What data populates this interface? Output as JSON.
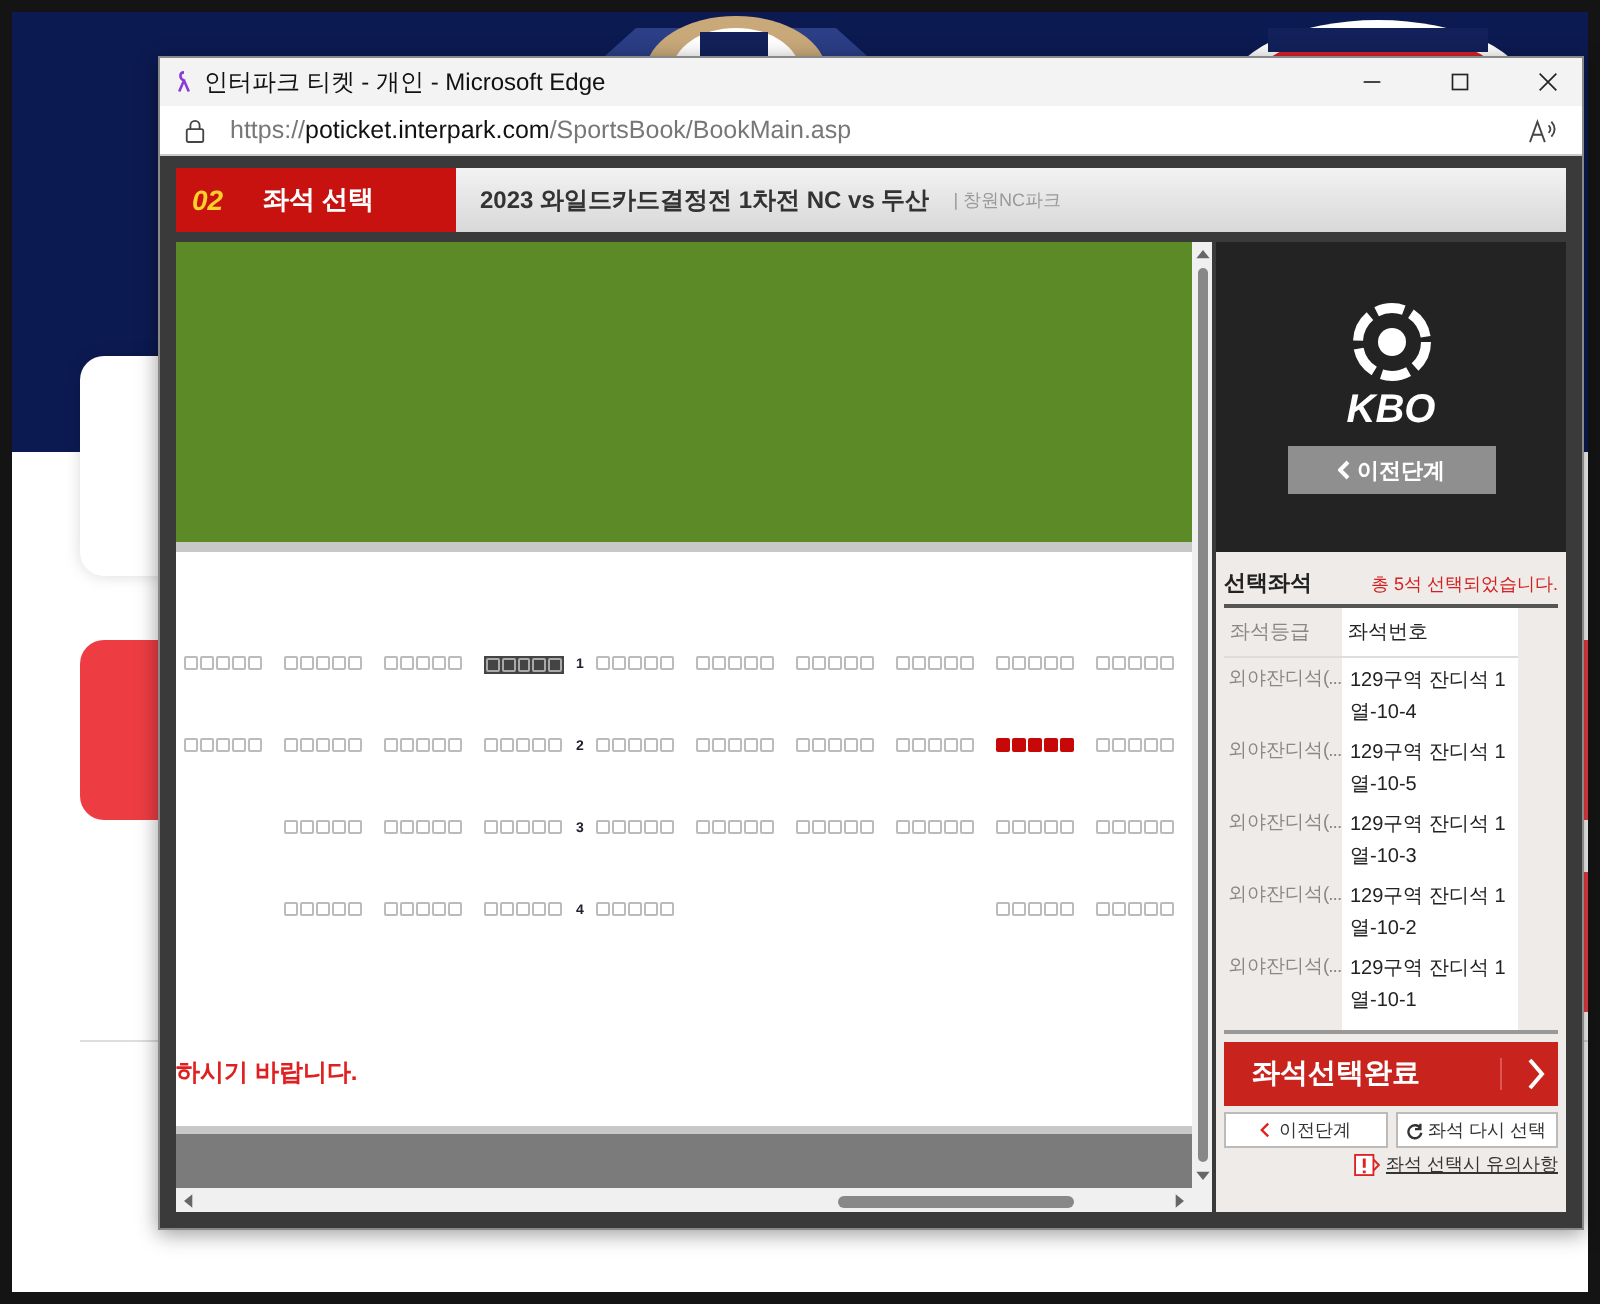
{
  "window": {
    "title": "인터파크 티켓 - 개인 - Microsoft Edge"
  },
  "address_bar": {
    "scheme": "https://",
    "host": "poticket.interpark.com",
    "path": "/SportsBook/BookMain.asp"
  },
  "step": {
    "number": "02",
    "label": "좌석 선택"
  },
  "event": {
    "title": "2023 와일드카드결정전 1차전 NC vs 두산",
    "venue": "| 창원NC파크"
  },
  "seat_rows": [
    {
      "label": "1",
      "blocks": [
        {
          "kind": "open"
        },
        {
          "kind": "open"
        },
        {
          "kind": "open"
        },
        {
          "kind": "taken"
        },
        {
          "kind": "open"
        },
        {
          "kind": "open"
        },
        {
          "kind": "open"
        },
        {
          "kind": "open"
        },
        {
          "kind": "open"
        },
        {
          "kind": "open"
        }
      ]
    },
    {
      "label": "2",
      "blocks": [
        {
          "kind": "open"
        },
        {
          "kind": "open"
        },
        {
          "kind": "open"
        },
        {
          "kind": "open"
        },
        {
          "kind": "open"
        },
        {
          "kind": "open"
        },
        {
          "kind": "open"
        },
        {
          "kind": "open"
        },
        {
          "kind": "selected"
        },
        {
          "kind": "open"
        }
      ]
    },
    {
      "label": "3",
      "blocks": [
        {
          "kind": "none"
        },
        {
          "kind": "open"
        },
        {
          "kind": "open"
        },
        {
          "kind": "open"
        },
        {
          "kind": "open"
        },
        {
          "kind": "open"
        },
        {
          "kind": "open"
        },
        {
          "kind": "open"
        },
        {
          "kind": "open"
        },
        {
          "kind": "open"
        }
      ]
    },
    {
      "label": "4",
      "blocks": [
        {
          "kind": "none"
        },
        {
          "kind": "open"
        },
        {
          "kind": "open"
        },
        {
          "kind": "open"
        },
        {
          "kind": "open"
        },
        {
          "kind": "none"
        },
        {
          "kind": "none"
        },
        {
          "kind": "none"
        },
        {
          "kind": "open"
        },
        {
          "kind": "open"
        }
      ]
    }
  ],
  "notice": "하시기 바랍니다.",
  "side_panel": {
    "logo_text": "KBO",
    "prev_button": "이전단계"
  },
  "selection": {
    "title": "선택좌석",
    "summary": "총 5석 선택되었습니다.",
    "columns": [
      "좌석등급",
      "좌석번호"
    ],
    "rows": [
      {
        "grade": "외야잔디석(...",
        "seat": "129구역 잔디석 1열-10-4"
      },
      {
        "grade": "외야잔디석(...",
        "seat": "129구역 잔디석 1열-10-5"
      },
      {
        "grade": "외야잔디석(...",
        "seat": "129구역 잔디석 1열-10-3"
      },
      {
        "grade": "외야잔디석(...",
        "seat": "129구역 잔디석 1열-10-2"
      },
      {
        "grade": "외야잔디석(...",
        "seat": "129구역 잔디석 1열-10-1"
      }
    ]
  },
  "buttons": {
    "complete": "좌석선택완료",
    "previous": "이전단계",
    "reselect": "좌석 다시 선택",
    "notice_link": "좌석 선택시 유의사항"
  }
}
